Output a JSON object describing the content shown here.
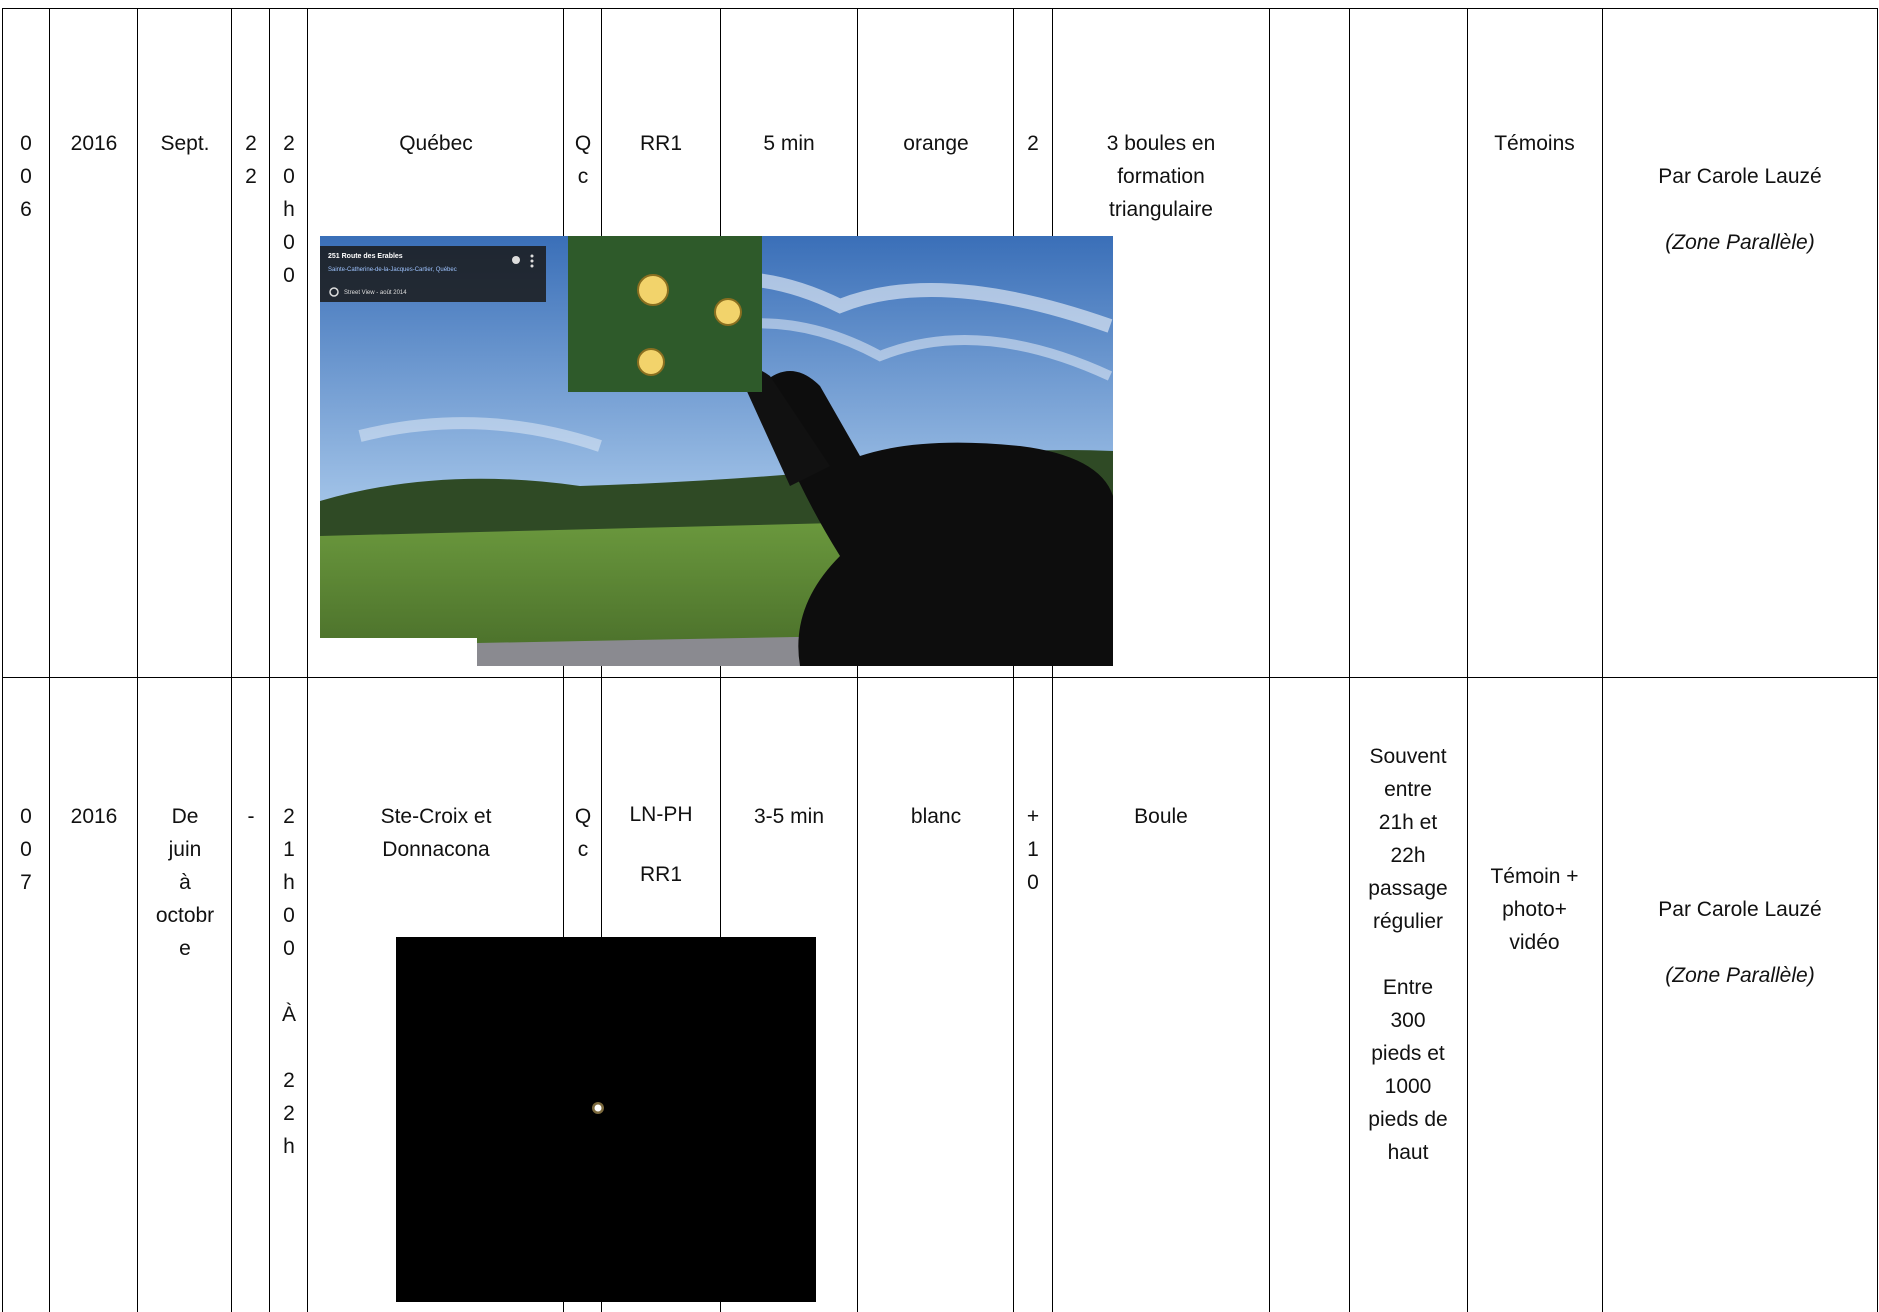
{
  "rows": [
    {
      "num": "0\n0\n6",
      "year": "2016",
      "month": "Sept.",
      "day": "2\n2",
      "hour": "2\n0\nh\n0\n0",
      "place": "Québec",
      "prov": "Q\nc",
      "code": "RR1",
      "duration": "5 min",
      "color": "orange",
      "count": "2",
      "shape": "3 boules en\nformation\ntriangulaire",
      "extra": "",
      "notes": "",
      "evidence": "Témoins",
      "source": "Par Carole Lauzé",
      "source_italic": "(Zone Parallèle)"
    },
    {
      "num": "0\n0\n7",
      "year": "2016",
      "month": "De\njuin\nà\noctobr\ne",
      "day": "-",
      "hour": "2\n1\nh\n0\n0\n\nÀ\n\n2\n2\nh",
      "place": "Ste-Croix et\nDonnacona",
      "prov": "Q\nc",
      "code": "LN-PH\n\nRR1",
      "duration": "3-5 min",
      "color": "blanc",
      "count": "+\n1\n0",
      "shape": "Boule",
      "extra": "",
      "notes": "Souvent\nentre\n21h et\n22h\npassage\nrégulier\n\nEntre\n300\npieds et\n1000\npieds de\nhaut",
      "evidence": "Témoin +\nphoto+\nvidéo",
      "source": "Par Carole Lauzé",
      "source_italic": "(Zone Parallèle)"
    }
  ],
  "photo1": {
    "address_title": "251 Route des Erables",
    "address_sub": "Sainte-Catherine-de-la-Jacques-Cartier, Québec",
    "streetview": "Street View - août 2014"
  },
  "colors": {
    "line": "#000000",
    "sky": "#6f9fd8",
    "grass": "#5e8a3a",
    "card": "#2e5a2a",
    "ball": "#f2d36b"
  }
}
